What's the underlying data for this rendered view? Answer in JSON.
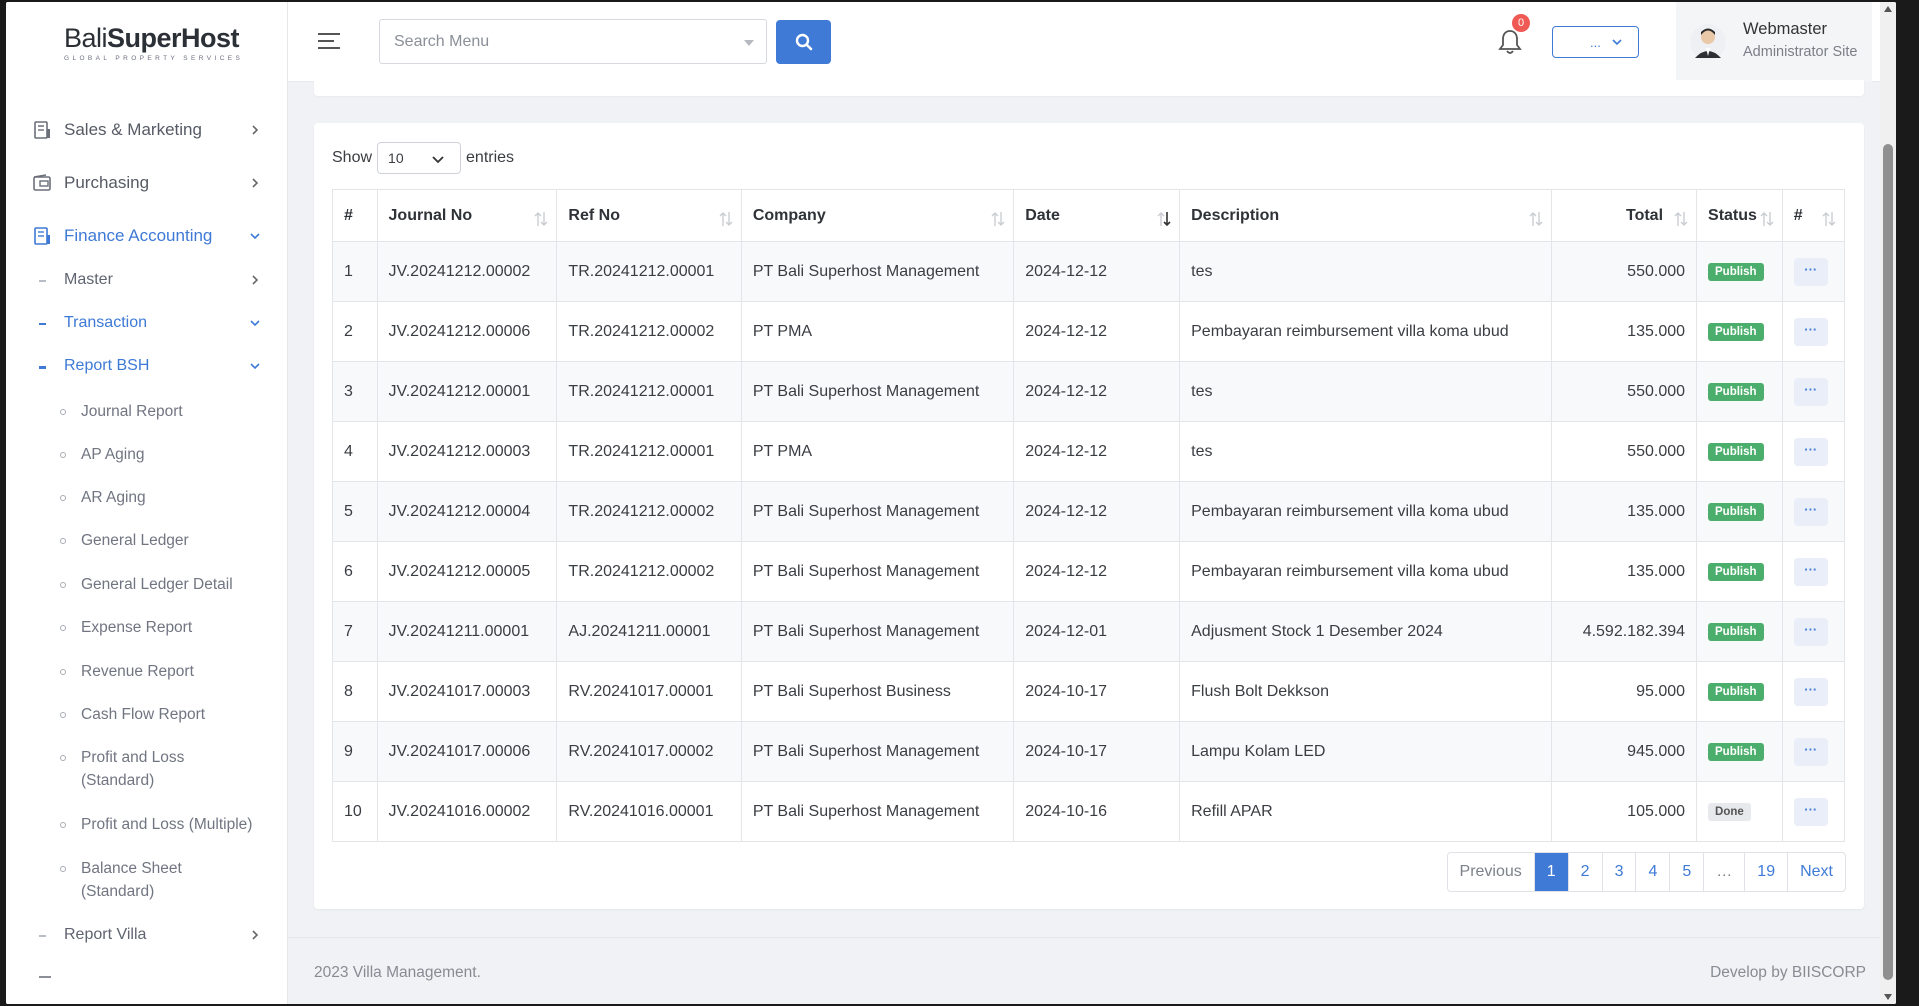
{
  "brand": {
    "prefix": "Bali",
    "main": "SuperHost",
    "tagline": "GLOBAL PROPERTY SERVICES"
  },
  "topbar": {
    "search_placeholder": "Search Menu",
    "notification_count": "0",
    "dropdown_label": "...",
    "user_name": "Webmaster",
    "user_role": "Administrator Site"
  },
  "sidebar": {
    "sales_marketing": "Sales & Marketing",
    "purchasing": "Purchasing",
    "finance_accounting": "Finance Accounting",
    "master": "Master",
    "transaction": "Transaction",
    "report_bsh": "Report BSH",
    "reports": [
      "Journal Report",
      "AP Aging",
      "AR Aging",
      "General Ledger",
      "General Ledger Detail",
      "Expense Report",
      "Revenue Report",
      "Cash Flow Report",
      "Profit and Loss (Standard)",
      "Profit and Loss (Multiple)",
      "Balance Sheet (Standard)"
    ],
    "report_villa": "Report Villa"
  },
  "table_controls": {
    "show": "Show",
    "entries_value": "10",
    "entries": "entries"
  },
  "table": {
    "headers": [
      "#",
      "Journal No",
      "Ref No",
      "Company",
      "Date",
      "Description",
      "Total",
      "Status",
      "#"
    ],
    "rows": [
      {
        "no": "1",
        "journal": "JV.20241212.00002",
        "ref": "TR.20241212.00001",
        "company": "PT Bali Superhost Management",
        "date": "2024-12-12",
        "desc": "tes",
        "total": "550.000",
        "status": "Publish",
        "action": "···"
      },
      {
        "no": "2",
        "journal": "JV.20241212.00006",
        "ref": "TR.20241212.00002",
        "company": "PT PMA",
        "date": "2024-12-12",
        "desc": "Pembayaran reimbursement villa koma ubud",
        "total": "135.000",
        "status": "Publish",
        "action": "···"
      },
      {
        "no": "3",
        "journal": "JV.20241212.00001",
        "ref": "TR.20241212.00001",
        "company": "PT Bali Superhost Management",
        "date": "2024-12-12",
        "desc": "tes",
        "total": "550.000",
        "status": "Publish",
        "action": "···"
      },
      {
        "no": "4",
        "journal": "JV.20241212.00003",
        "ref": "TR.20241212.00001",
        "company": "PT PMA",
        "date": "2024-12-12",
        "desc": "tes",
        "total": "550.000",
        "status": "Publish",
        "action": "···"
      },
      {
        "no": "5",
        "journal": "JV.20241212.00004",
        "ref": "TR.20241212.00002",
        "company": "PT Bali Superhost Management",
        "date": "2024-12-12",
        "desc": "Pembayaran reimbursement villa koma ubud",
        "total": "135.000",
        "status": "Publish",
        "action": "···"
      },
      {
        "no": "6",
        "journal": "JV.20241212.00005",
        "ref": "TR.20241212.00002",
        "company": "PT Bali Superhost Management",
        "date": "2024-12-12",
        "desc": "Pembayaran reimbursement villa koma ubud",
        "total": "135.000",
        "status": "Publish",
        "action": "···"
      },
      {
        "no": "7",
        "journal": "JV.20241211.00001",
        "ref": "AJ.20241211.00001",
        "company": "PT Bali Superhost Management",
        "date": "2024-12-01",
        "desc": "Adjusment Stock 1 Desember 2024",
        "total": "4.592.182.394",
        "status": "Publish",
        "action": "···"
      },
      {
        "no": "8",
        "journal": "JV.20241017.00003",
        "ref": "RV.20241017.00001",
        "company": "PT Bali Superhost Business",
        "date": "2024-10-17",
        "desc": "Flush Bolt Dekkson",
        "total": "95.000",
        "status": "Publish",
        "action": "···"
      },
      {
        "no": "9",
        "journal": "JV.20241017.00006",
        "ref": "RV.20241017.00002",
        "company": "PT Bali Superhost Management",
        "date": "2024-10-17",
        "desc": "Lampu Kolam LED",
        "total": "945.000",
        "status": "Publish",
        "action": "···"
      },
      {
        "no": "10",
        "journal": "JV.20241016.00002",
        "ref": "RV.20241016.00001",
        "company": "PT Bali Superhost Management",
        "date": "2024-10-16",
        "desc": "Refill APAR",
        "total": "105.000",
        "status": "Done",
        "action": "···"
      }
    ]
  },
  "pagination": {
    "previous": "Previous",
    "pages": [
      "1",
      "2",
      "3",
      "4",
      "5",
      "…",
      "19"
    ],
    "next": "Next",
    "current": "1"
  },
  "footer": {
    "left": "2023 Villa Management.",
    "right": "Develop by BIISCORP"
  },
  "colors": {
    "accent": "#3e7ad6",
    "publish": "#4cae6c",
    "danger": "#ef5a55"
  }
}
